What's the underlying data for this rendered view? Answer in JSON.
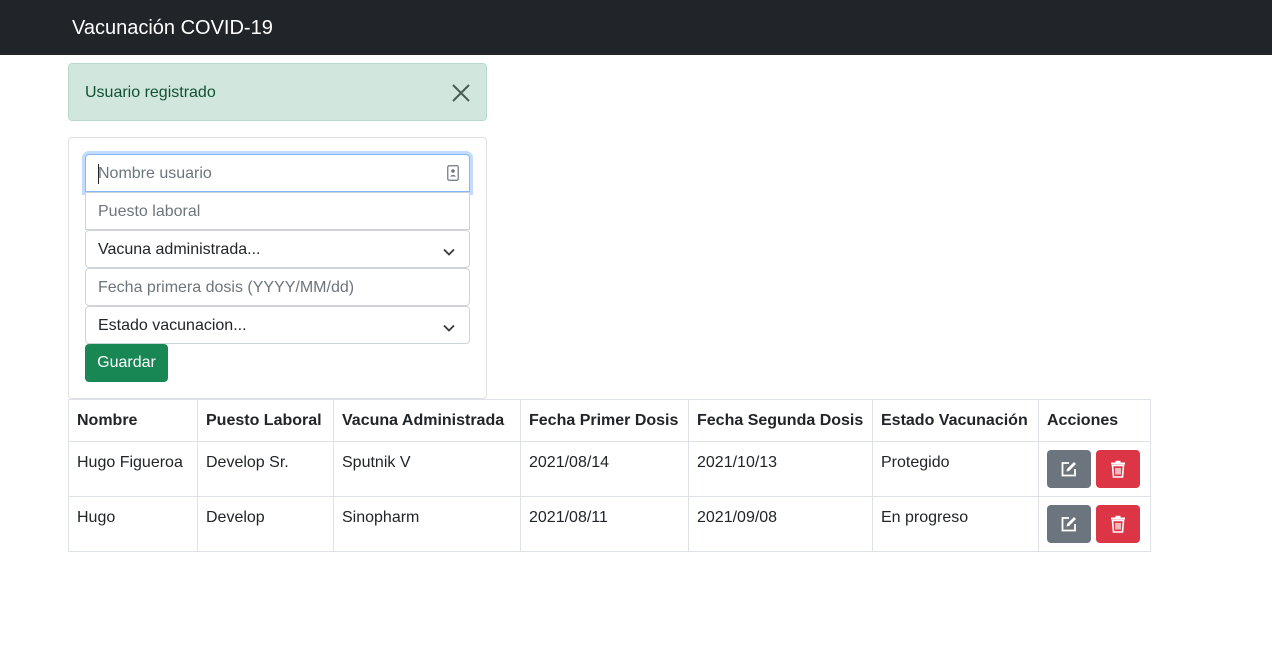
{
  "navbar": {
    "title": "Vacunación COVID-19"
  },
  "alert": {
    "message": "Usuario registrado",
    "close_icon": "close-icon"
  },
  "form": {
    "name_placeholder": "Nombre usuario",
    "job_placeholder": "Puesto laboral",
    "vaccine_select": "Vacuna administrada...",
    "first_dose_placeholder": "Fecha primera dosis (YYYY/MM/dd)",
    "status_select": "Estado vacunacion...",
    "save_label": "Guardar"
  },
  "table": {
    "headers": [
      "Nombre",
      "Puesto Laboral",
      "Vacuna Administrada",
      "Fecha Primer Dosis",
      "Fecha Segunda Dosis",
      "Estado Vacunación",
      "Acciones"
    ],
    "rows": [
      [
        "Hugo Figueroa",
        "Develop Sr.",
        "Sputnik V",
        "2021/08/14",
        "2021/10/13",
        "Protegido"
      ],
      [
        "Hugo",
        "Develop",
        "Sinopharm",
        "2021/08/11",
        "2021/09/08",
        "En progreso"
      ]
    ]
  },
  "colors": {
    "navbar": "#212529",
    "alert_bg": "#d1e7dd",
    "alert_text": "#0f5132",
    "save_button": "#198754",
    "edit_button": "#6c757d",
    "delete_button": "#dc3545"
  }
}
